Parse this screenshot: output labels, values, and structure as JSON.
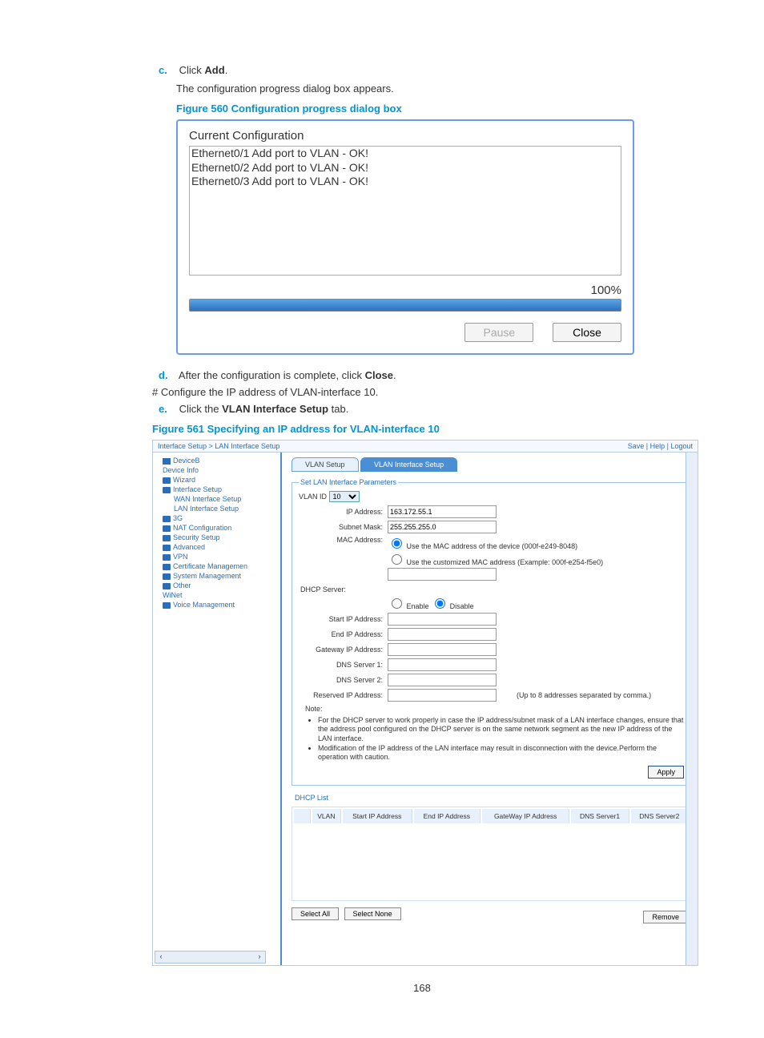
{
  "steps": {
    "c": {
      "label": "c.",
      "text_before": "Click ",
      "bold": "Add",
      "text_after": "."
    },
    "c_sub": "The configuration progress dialog box appears.",
    "d": {
      "label": "d.",
      "text_before": "After the configuration is complete, click ",
      "bold": "Close",
      "text_after": "."
    },
    "hash": "# Configure the IP address of VLAN-interface 10.",
    "e": {
      "label": "e.",
      "text_before": "Click the ",
      "bold": "VLAN Interface Setup",
      "text_after": " tab."
    }
  },
  "fig560": {
    "caption": "Figure 560 Configuration progress dialog box",
    "title": "Current Configuration",
    "lines": [
      "Ethernet0/1 Add port to VLAN - OK!",
      "Ethernet0/2 Add port to VLAN - OK!",
      "Ethernet0/3 Add port to VLAN - OK!"
    ],
    "percent": "100%",
    "pause": "Pause",
    "close": "Close"
  },
  "fig561": {
    "caption": "Figure 561 Specifying an IP address for VLAN-interface 10",
    "breadcrumb": "Interface Setup > LAN Interface Setup",
    "top_links": "Save | Help | Logout",
    "tree": {
      "root": "DeviceB",
      "items": [
        "Device Info",
        "Wizard",
        "Interface Setup",
        "WAN Interface Setup",
        "LAN Interface Setup",
        "3G",
        "NAT Configuration",
        "Security Setup",
        "Advanced",
        "VPN",
        "Certificate Managemen",
        "System Management",
        "Other",
        "WiNet",
        "Voice Management"
      ]
    },
    "tabs": {
      "inactive": "VLAN Setup",
      "active": "VLAN Interface Setup"
    },
    "fieldset": {
      "legend": "Set LAN Interface Parameters",
      "vlanid_label": "VLAN ID",
      "vlanid_value": "10",
      "ip_label": "IP Address:",
      "ip_value": "163.172.55.1",
      "mask_label": "Subnet Mask:",
      "mask_value": "255.255.255.0",
      "mac_label": "MAC Address:",
      "mac_opt1": "Use the MAC address of the device (000f-e249-8048)",
      "mac_opt2": "Use the customized MAC address (Example: 000f-e254-f5e0)",
      "dhcp_label": "DHCP Server:",
      "dhcp_enable": "Enable",
      "dhcp_disable": "Disable",
      "start_label": "Start IP Address:",
      "end_label": "End IP Address:",
      "gw_label": "Gateway IP Address:",
      "dns1_label": "DNS Server 1:",
      "dns2_label": "DNS Server 2:",
      "res_label": "Reserved IP Address:",
      "res_hint": "(Up to 8 addresses separated by comma.)",
      "note": "Note:",
      "note1": "For the DHCP server to work properly in case the IP address/subnet mask of a LAN interface changes, ensure that the address pool configured on the DHCP server is on the same network segment as the new IP address of the LAN interface.",
      "note2": "Modification of the IP address of the LAN interface may result in disconnection with the device.Perform the operation with caution.",
      "apply": "Apply"
    },
    "dhcp_list": {
      "title": "DHCP List",
      "cols": [
        "VLAN",
        "Start IP Address",
        "End IP Address",
        "GateWay IP Address",
        "DNS Server1",
        "DNS Server2"
      ],
      "select_all": "Select All",
      "select_none": "Select None",
      "remove": "Remove"
    }
  },
  "page_number": "168"
}
